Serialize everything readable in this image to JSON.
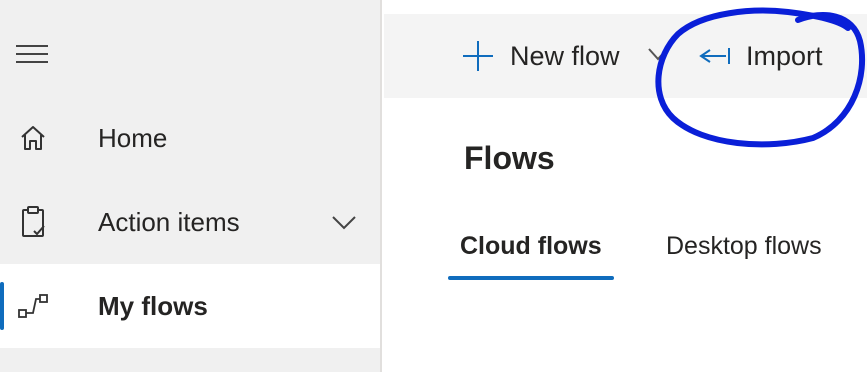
{
  "sidebar": {
    "items": [
      {
        "label": "Home",
        "icon": "home-icon"
      },
      {
        "label": "Action items",
        "icon": "clipboard-check-icon",
        "expandable": true
      },
      {
        "label": "My flows",
        "icon": "flow-icon",
        "active": true
      }
    ]
  },
  "commandbar": {
    "new_flow_label": "New flow",
    "import_label": "Import"
  },
  "main": {
    "title": "Flows",
    "tabs": [
      {
        "label": "Cloud flows",
        "selected": true
      },
      {
        "label": "Desktop flows",
        "selected": false
      }
    ]
  },
  "colors": {
    "accent": "#0f6cbd",
    "annotation": "#0a1fd8",
    "sidebar_bg": "#f0f0f0",
    "commandbar_bg": "#f4f4f4"
  }
}
